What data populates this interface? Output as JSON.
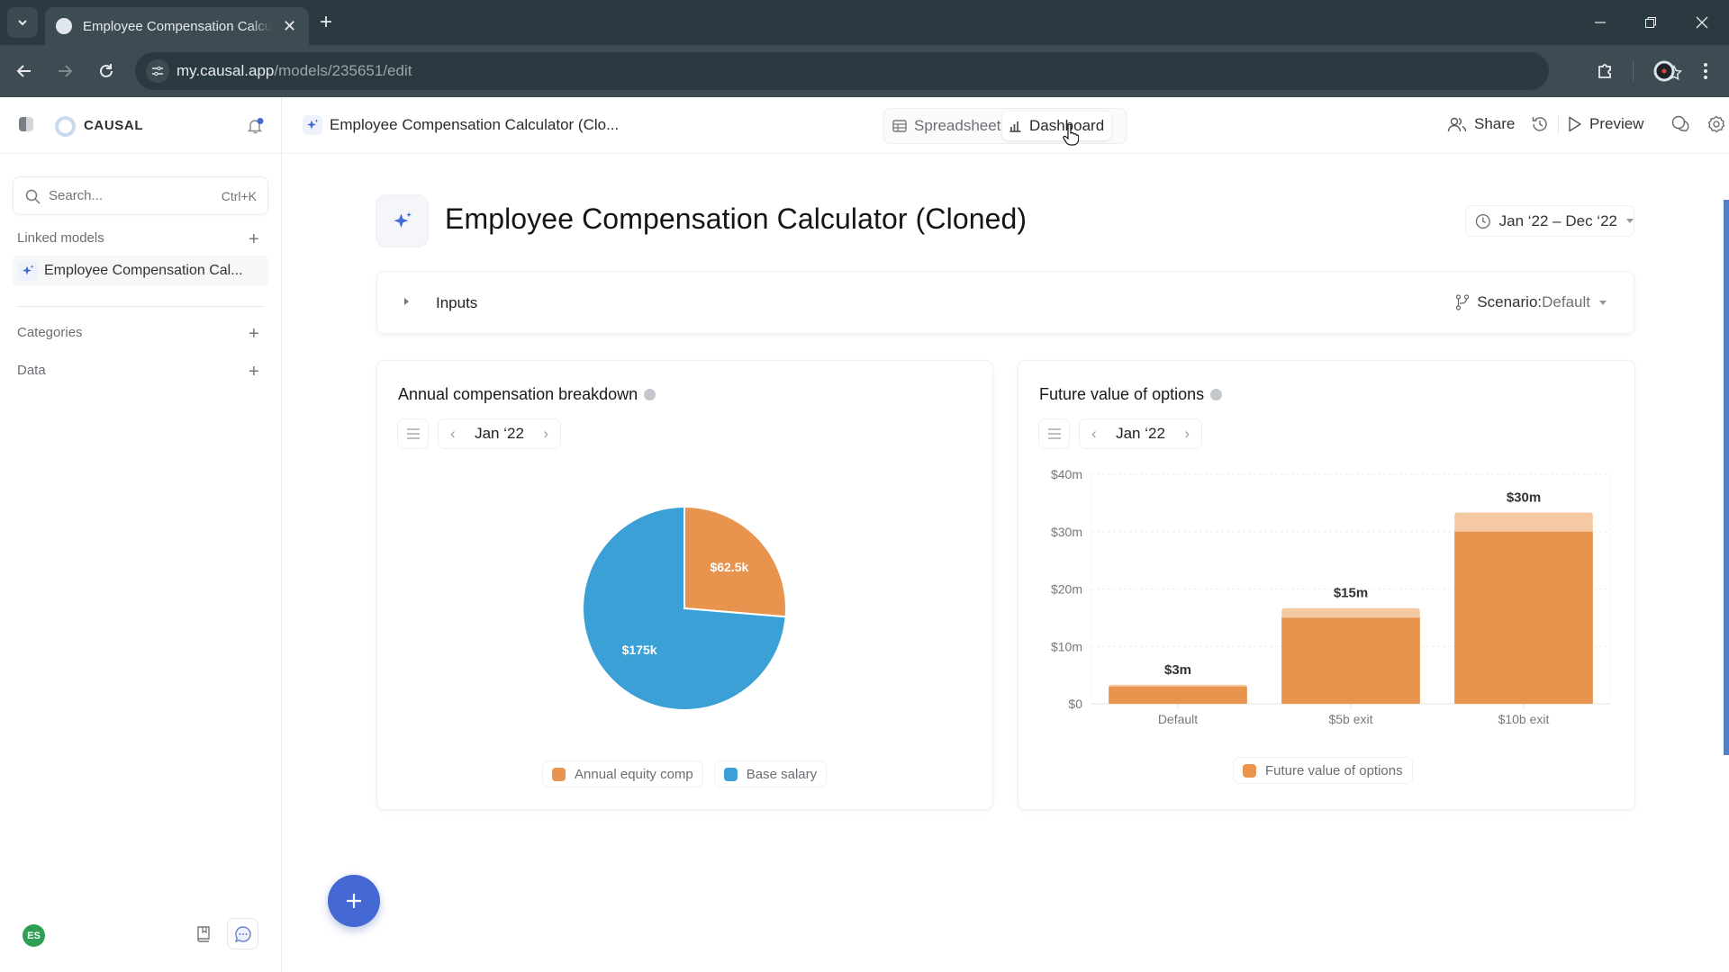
{
  "browser": {
    "tab_title": "Employee Compensation Calculator (Cloned) | Causal",
    "url_host": "my.causal.app",
    "url_path": "/models/235651/edit"
  },
  "sidebar": {
    "brand": "CAUSAL",
    "search_placeholder": "Search...",
    "search_shortcut": "Ctrl+K",
    "sections": [
      {
        "label": "Linked models"
      },
      {
        "label": "Categories"
      },
      {
        "label": "Data"
      }
    ],
    "linked_models": [
      {
        "label": "Employee Compensation Cal..."
      }
    ],
    "user_initials": "ES"
  },
  "appbar": {
    "breadcrumb_title": "Employee Compensation Calculator (Clo...",
    "views": [
      {
        "label": "Spreadsheet",
        "active": false
      },
      {
        "label": "Dashboard",
        "active": true
      }
    ],
    "share_label": "Share",
    "preview_label": "Preview"
  },
  "page": {
    "title": "Employee Compensation Calculator (Cloned)",
    "date_range": "Jan ‘22 – Dec ‘22",
    "inputs_label": "Inputs",
    "scenario_label": "Scenario:",
    "scenario_value": "Default"
  },
  "colors": {
    "equity": "#e8944e",
    "salary": "#3aa0d6",
    "options": "#e8944e",
    "options_light": "#f4c9a3",
    "accent": "#4468d4"
  },
  "chart_data": [
    {
      "type": "pie",
      "title": "Annual compensation breakdown",
      "period": "Jan ‘22",
      "labels": [
        "Annual equity comp",
        "Base salary"
      ],
      "values": [
        62500,
        175000
      ],
      "data_labels": [
        "$62.5k",
        "$175k"
      ],
      "legend": [
        "Annual equity comp",
        "Base salary"
      ],
      "legend_position": "bottom"
    },
    {
      "type": "bar",
      "title": "Future value of options",
      "period": "Jan ‘22",
      "categories": [
        "Default",
        "$5b exit",
        "$10b exit"
      ],
      "series": [
        {
          "name": "Future value of options",
          "values": [
            3,
            15,
            30
          ],
          "upper_values": [
            3.33,
            16.67,
            33.33
          ]
        }
      ],
      "data_labels": [
        "$3m",
        "$15m",
        "$30m"
      ],
      "y_unit": "millions USD",
      "yticks": [
        "$0",
        "$10m",
        "$20m",
        "$30m",
        "$40m"
      ],
      "ylim": [
        0,
        40
      ],
      "grid": true,
      "xlabel": "",
      "ylabel": "",
      "legend": [
        "Future value of options"
      ],
      "legend_position": "bottom"
    }
  ]
}
